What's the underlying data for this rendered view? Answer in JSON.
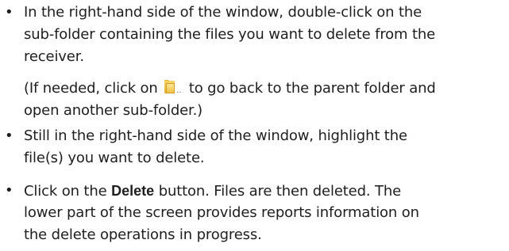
{
  "bullet_char": "•",
  "items": [
    {
      "lines": [
        "In the right-hand side of the window, double-click on the",
        "sub-folder containing the files you want to delete from the",
        "receiver."
      ]
    },
    {
      "note_line1_before": "(If needed, click on",
      "note_icon_label": "..",
      "note_line1_after": "to go back to the parent folder and",
      "note_line2": "open another sub-folder.)"
    },
    {
      "lines": [
        "Still in the right-hand side of the window, highlight the",
        "file(s) you want to delete."
      ]
    },
    {
      "line1_before": "Click on the",
      "line1_bold": "Delete",
      "line1_after": "button. Files are then deleted. The",
      "lines_rest": [
        "lower part of the screen provides reports information on",
        "the delete operations in progress."
      ]
    }
  ],
  "icons": {
    "parent_folder": "folder-up-icon"
  }
}
